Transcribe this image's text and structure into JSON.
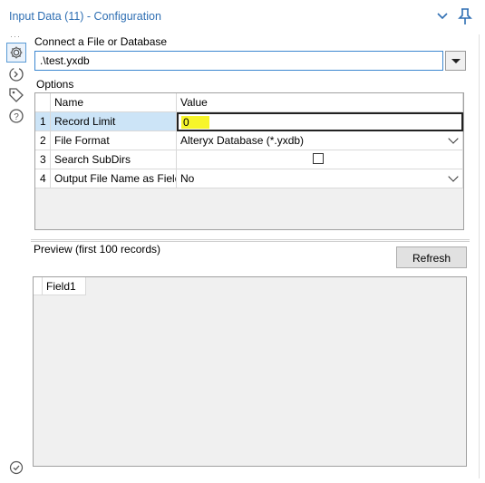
{
  "window": {
    "title": "Input Data (11) - Configuration"
  },
  "rail": {
    "icons": [
      "gear-icon",
      "connection-icon",
      "tag-icon",
      "help-icon"
    ],
    "more": "···"
  },
  "connect": {
    "label": "Connect a File or Database",
    "value": ".\\test.yxdb"
  },
  "options": {
    "label": "Options",
    "headers": {
      "name": "Name",
      "value": "Value"
    },
    "rows": [
      {
        "num": "1",
        "name": "Record Limit",
        "value": "0"
      },
      {
        "num": "2",
        "name": "File Format",
        "value": "Alteryx Database (*.yxdb)"
      },
      {
        "num": "3",
        "name": "Search SubDirs",
        "value": ""
      },
      {
        "num": "4",
        "name": "Output File Name as Field",
        "value": "No"
      }
    ]
  },
  "preview": {
    "label": "Preview (first 100 records)",
    "refresh_label": "Refresh",
    "columns": [
      "Field1"
    ]
  },
  "colors": {
    "title": "#2f6fb3",
    "selection": "#cce4f7",
    "highlight": "#f7f52a"
  }
}
